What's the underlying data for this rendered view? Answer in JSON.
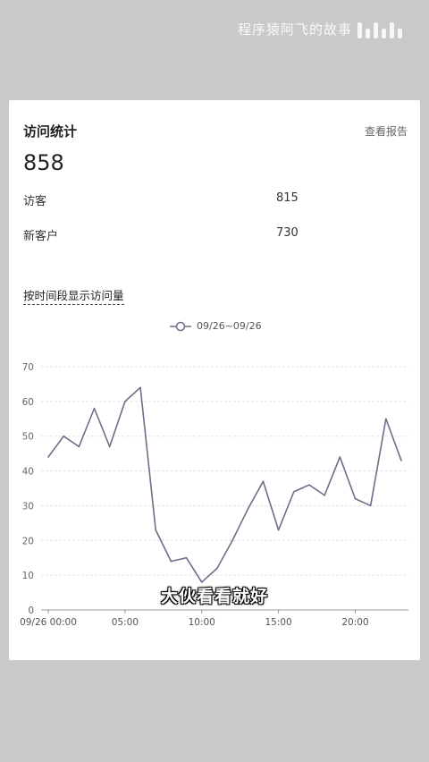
{
  "watermark": {
    "text": "程序猿阿飞的故事",
    "logo": "bilibili"
  },
  "card": {
    "title": "访问统计",
    "report_link": "查看报告",
    "total": "858",
    "stats": [
      {
        "label": "访客",
        "value": "815"
      },
      {
        "label": "新客户",
        "value": "730"
      }
    ],
    "period_link": "按时间段显示访问量"
  },
  "chart_data": {
    "type": "line",
    "series": [
      {
        "name": "09/26~09/26",
        "x": [
          "00:00",
          "01:00",
          "02:00",
          "03:00",
          "04:00",
          "05:00",
          "06:00",
          "07:00",
          "08:00",
          "09:00",
          "10:00",
          "11:00",
          "12:00",
          "13:00",
          "14:00",
          "15:00",
          "16:00",
          "17:00",
          "18:00",
          "19:00",
          "20:00",
          "21:00",
          "22:00",
          "23:00"
        ],
        "values": [
          44,
          50,
          47,
          58,
          47,
          60,
          64,
          23,
          14,
          15,
          8,
          12,
          20,
          29,
          37,
          23,
          34,
          36,
          33,
          44,
          32,
          30,
          55,
          43
        ],
        "color": "#6e6e87"
      }
    ],
    "ylim": [
      0,
      70
    ],
    "yticks": [
      "0",
      "10",
      "20",
      "30",
      "40",
      "50",
      "60",
      "70"
    ],
    "xtick_labels": [
      "09/26 00:00",
      "05:00",
      "10:00",
      "15:00",
      "20:00"
    ],
    "xtick_index": [
      0,
      5,
      10,
      15,
      20
    ],
    "grid": true,
    "legend_position": "top-center"
  },
  "subtitle": "大伙看看就好"
}
